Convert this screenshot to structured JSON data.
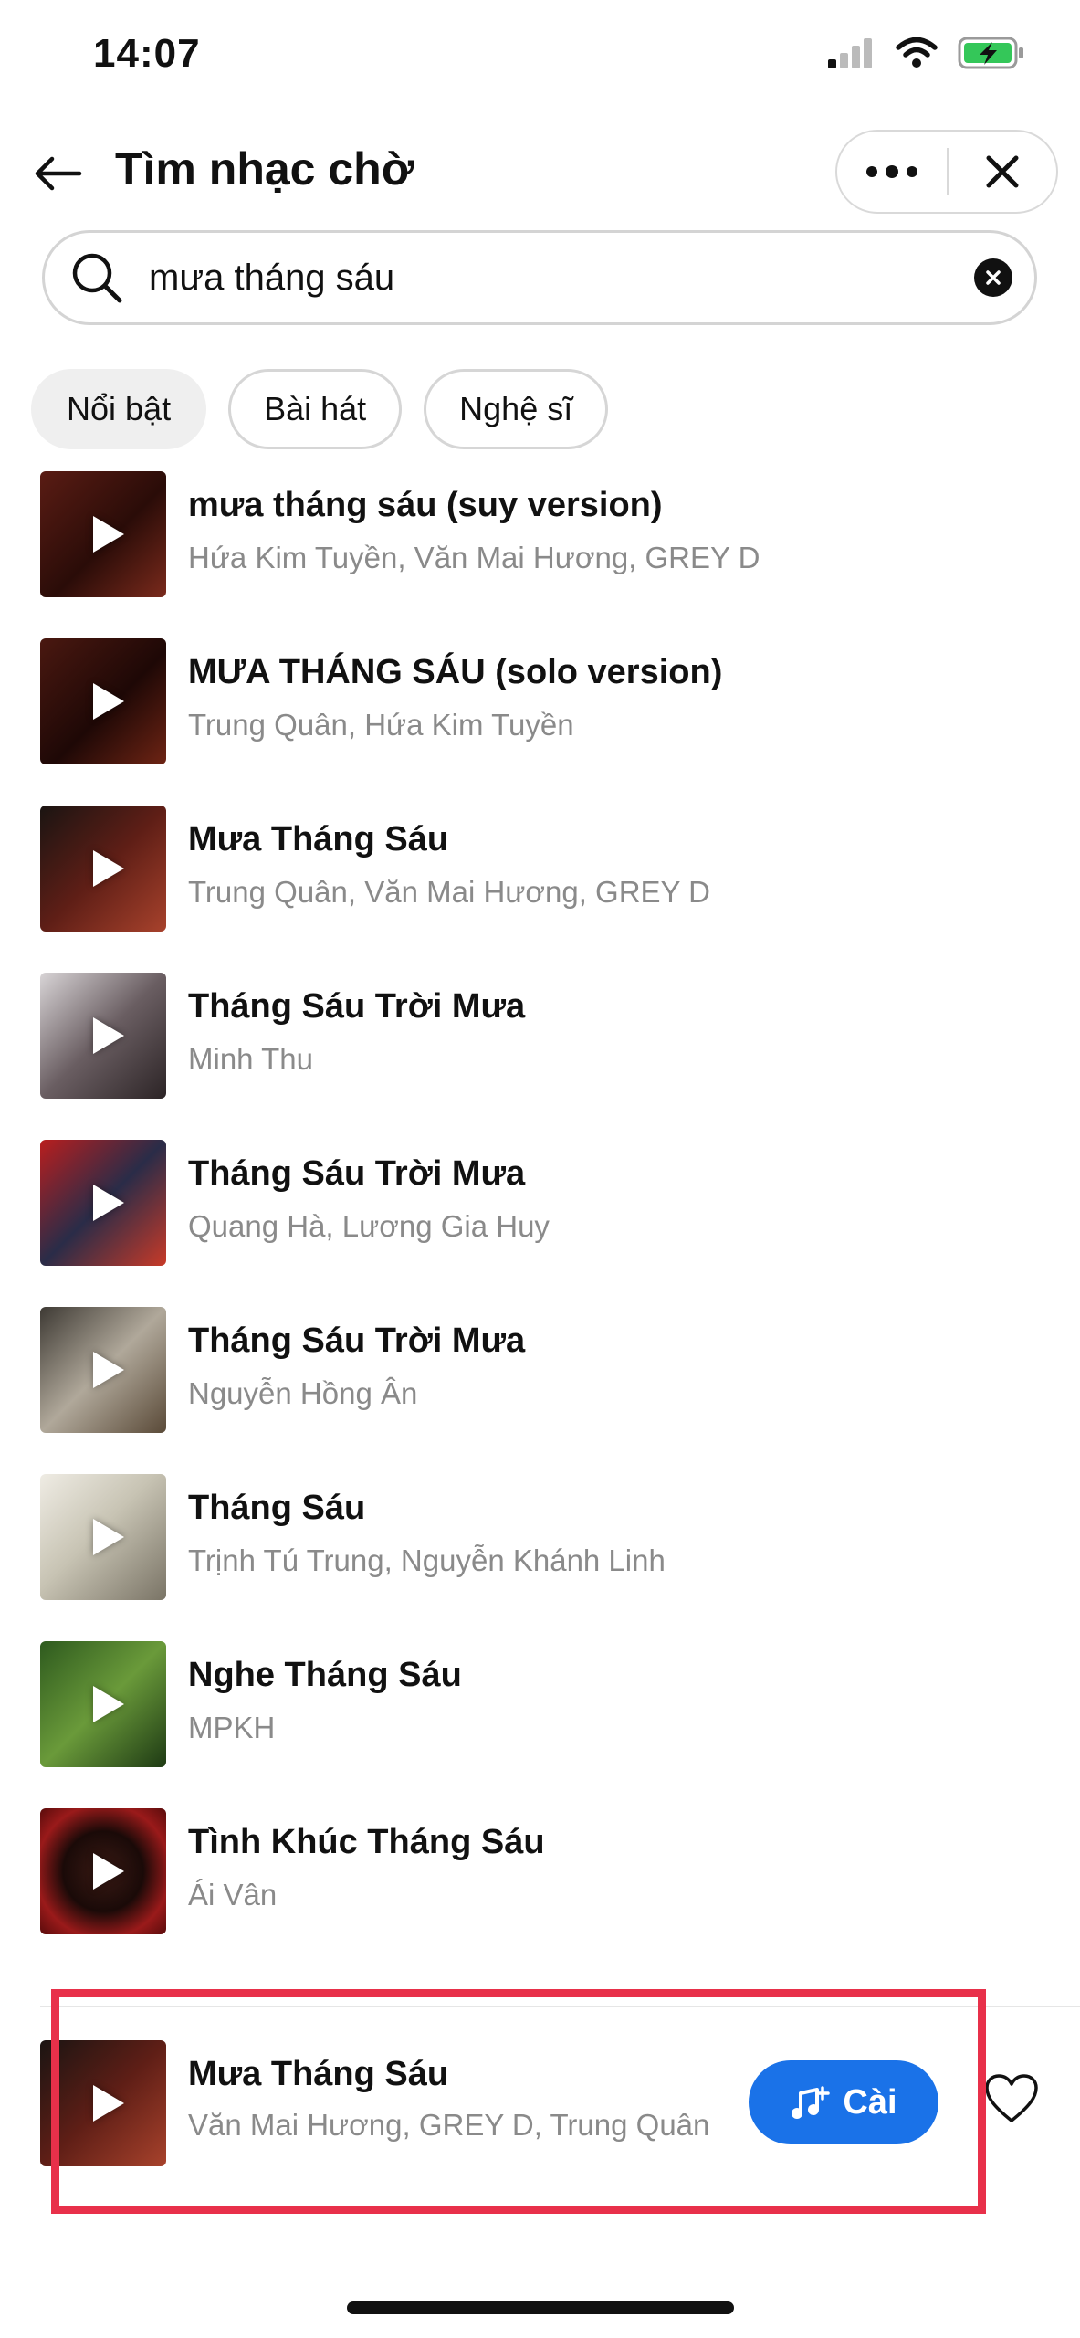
{
  "status_bar": {
    "time": "14:07",
    "battery_color": "#34c759"
  },
  "header": {
    "title": "Tìm nhạc chờ",
    "back_icon": "arrow-left-icon",
    "more_icon": "more-dots-icon",
    "close_icon": "close-icon"
  },
  "search": {
    "value": "mưa tháng sáu",
    "placeholder": ""
  },
  "tabs": [
    {
      "label": "Nổi bật",
      "active": true
    },
    {
      "label": "Bài hát",
      "active": false
    },
    {
      "label": "Nghệ sĩ",
      "active": false
    }
  ],
  "results": [
    {
      "title": "mưa tháng sáu (suy version)",
      "artist": "Hứa Kim Tuyền, Văn Mai Hương, GREY D"
    },
    {
      "title": "MƯA THÁNG SÁU (solo version)",
      "artist": "Trung Quân, Hứa Kim Tuyền"
    },
    {
      "title": "Mưa Tháng Sáu",
      "artist": "Trung Quân, Văn Mai Hương, GREY D"
    },
    {
      "title": "Tháng Sáu Trời Mưa",
      "artist": "Minh Thu"
    },
    {
      "title": "Tháng Sáu Trời Mưa",
      "artist": "Quang Hà, Lương Gia Huy"
    },
    {
      "title": "Tháng Sáu Trời Mưa",
      "artist": "Nguyễn Hồng Ân"
    },
    {
      "title": "Tháng Sáu",
      "artist": "Trịnh Tú Trung, Nguyễn Khánh Linh"
    },
    {
      "title": "Nghe Tháng Sáu",
      "artist": "MPKH"
    },
    {
      "title": "Tình Khúc Tháng Sáu",
      "artist": "Ái Vân"
    }
  ],
  "now_playing": {
    "title": "Mưa Tháng Sáu",
    "artist": "Văn Mai Hương, GREY D, Trung Quân",
    "set_button": "Cài",
    "highlight_color": "#e8304a",
    "accent_color": "#1a72e8"
  }
}
